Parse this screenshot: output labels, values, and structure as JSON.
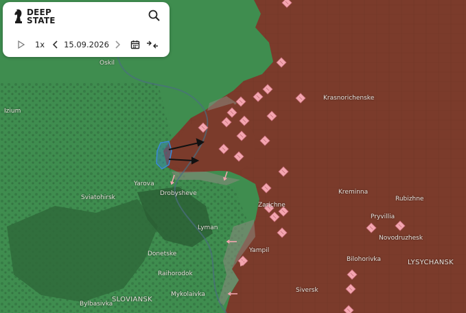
{
  "brand": {
    "line1": "DEEP",
    "line2": "STATE",
    "icon": "knight-chess-icon"
  },
  "controls": {
    "speed": "1x",
    "date": "15.09.2026",
    "icons": [
      "play-icon",
      "chevron-left-icon",
      "chevron-right-icon",
      "calendar-icon",
      "compress-arrows-icon",
      "search-icon"
    ]
  },
  "colors": {
    "occupied": "#7a3a2a",
    "liberated": "#3e8a4e",
    "contested_outline": "#3a8ad8",
    "marker": "#f4a6b0",
    "arrow": "#111111"
  },
  "places": [
    {
      "name": "Oskil"
    },
    {
      "name": "Izium"
    },
    {
      "name": "Krasnorichenske"
    },
    {
      "name": "Yarova"
    },
    {
      "name": "Sviatohirsk"
    },
    {
      "name": "Drobysheve"
    },
    {
      "name": "Kreminna"
    },
    {
      "name": "Rubizhne"
    },
    {
      "name": "Zarichne"
    },
    {
      "name": "Pryvillia"
    },
    {
      "name": "Lyman"
    },
    {
      "name": "Novodruzhesk"
    },
    {
      "name": "Donetske"
    },
    {
      "name": "Yampil"
    },
    {
      "name": "Bilohorivka"
    },
    {
      "name": "LYSYCHANSK"
    },
    {
      "name": "Raihorodok"
    },
    {
      "name": "Siversk"
    },
    {
      "name": "SLOVIANSK"
    },
    {
      "name": "Mykolaivka"
    },
    {
      "name": "Bylbasivka"
    }
  ]
}
